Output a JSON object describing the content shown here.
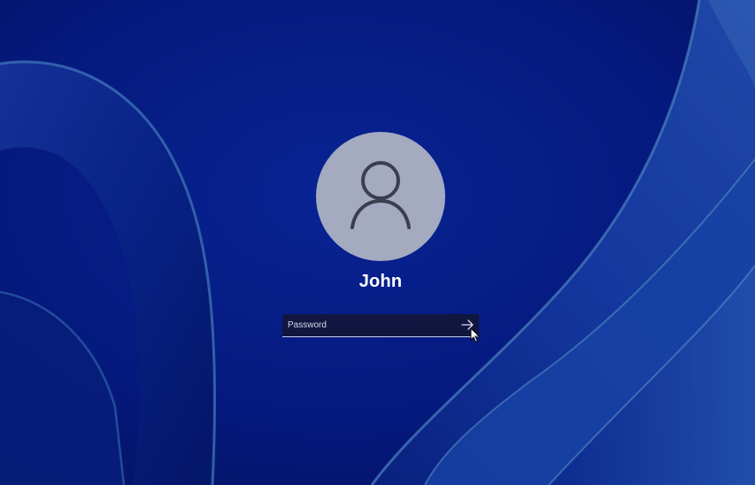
{
  "user": {
    "name": "John"
  },
  "password_field": {
    "placeholder": "Password",
    "value": ""
  },
  "icons": {
    "avatar": "person-icon",
    "submit": "arrow-right-icon",
    "cursor": "mouse-pointer-icon"
  },
  "colors": {
    "background": "#08209a",
    "avatar_fill": "#a4aac0",
    "avatar_glyph": "#3b3e4e",
    "text": "#ffffff"
  }
}
